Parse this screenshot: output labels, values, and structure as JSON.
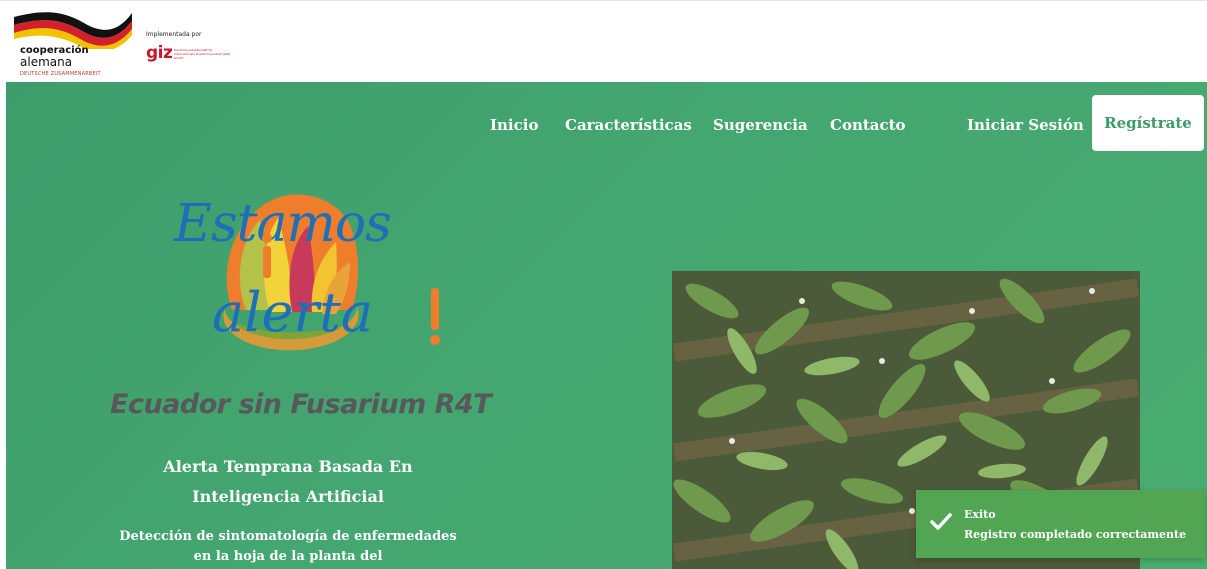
{
  "partners": {
    "coop_line1": "cooperación",
    "coop_line2": "alemana",
    "coop_line3": "DEUTSCHE ZUSAMMENARBEIT",
    "implementada": "Implementada por",
    "giz": "giz",
    "giz_small": "Deutsche Gesellschaft für Internationale Zusammenarbeit (GIZ) GmbH"
  },
  "nav": {
    "items": [
      "Inicio",
      "Características",
      "Sugerencia",
      "Contacto"
    ],
    "login": "Iniciar Sesión",
    "register": "Regístrate"
  },
  "hero": {
    "logo_line1": "Estamos",
    "logo_line2": "alerta",
    "tagline": "Ecuador sin Fusarium R4T",
    "subtitle": "Alerta Temprana Basada En Inteligencia Artificial",
    "description": "Detección de sintomatología de enfermedades en la hoja de la planta del"
  },
  "toast": {
    "title": "Exito",
    "message": "Registro completado correctamente",
    "icon": "check-icon"
  },
  "colors": {
    "hero_bg": "#44a670",
    "accent_blue": "#1d6fb8",
    "register_text": "#3c9b66",
    "toast_bg": "#52a653"
  }
}
